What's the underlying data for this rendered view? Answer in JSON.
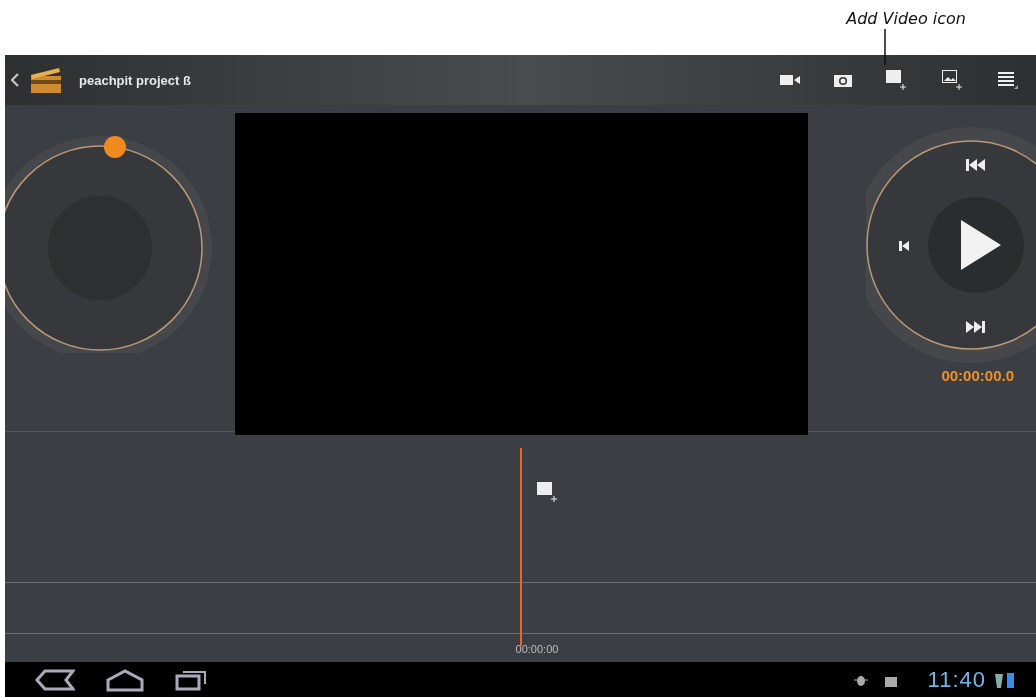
{
  "annotation": {
    "text": "Add Video icon"
  },
  "action_bar": {
    "title": "peachpit project ß"
  },
  "playback": {
    "timecode": "00:00:00.0"
  },
  "timeline": {
    "timecode": "00:00:00"
  },
  "status_bar": {
    "time": "11:40"
  }
}
